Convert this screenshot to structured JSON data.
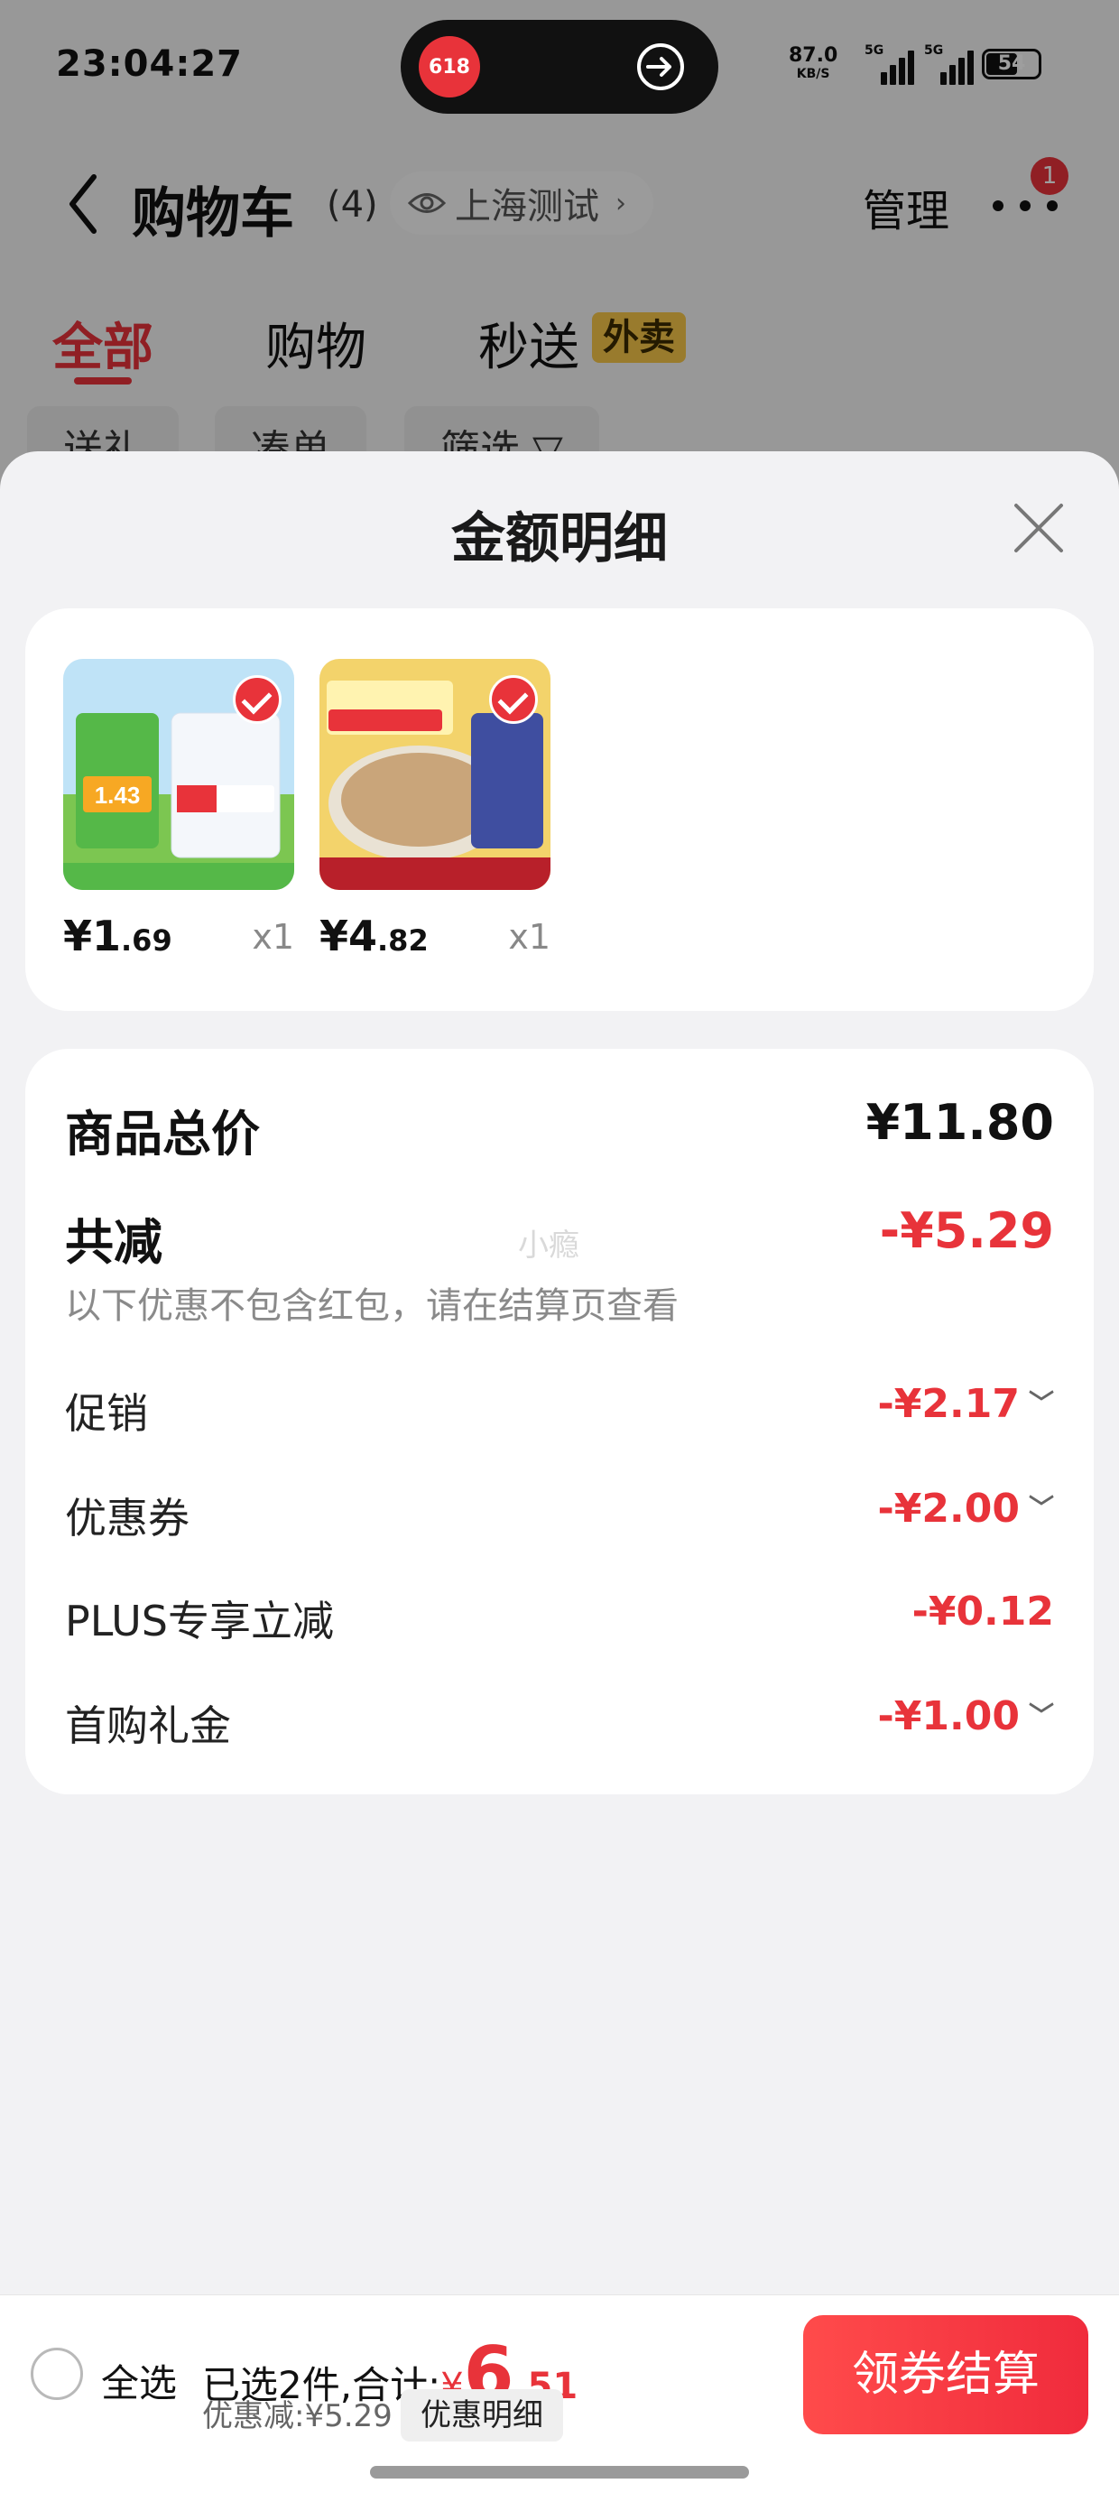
{
  "status_bar": {
    "time": "23:04:27",
    "island_logo": "618",
    "net_speed": "87.0",
    "net_unit": "KB/S",
    "sim1": "5G",
    "sim2": "5G",
    "battery": "54"
  },
  "nav": {
    "title": "购物车",
    "count": "(4)",
    "location": "上海测试",
    "manage": "管理",
    "badge": "1"
  },
  "tabs": [
    {
      "label": "全部",
      "active": true
    },
    {
      "label": "购物",
      "active": false
    },
    {
      "label": "秒送",
      "active": false
    }
  ],
  "tab_tag": "外卖",
  "chips": [
    "送礼",
    "凑单",
    "筛选 ▽"
  ],
  "sheet": {
    "title": "金额明细",
    "products": [
      {
        "price_int": "¥1",
        "price_dec": ".69",
        "qty": "x1",
        "image": "salt-package-image"
      },
      {
        "price_int": "¥4",
        "price_dec": ".82",
        "qty": "x1",
        "image": "oat-rice-package-image"
      }
    ],
    "total_label": "商品总价",
    "total_value": "¥11.80",
    "reduce_label": "共减",
    "reduce_value": "-¥5.29",
    "reduce_note": "以下优惠不包含红包，请在结算页查看",
    "watermark": "小瘾",
    "details": [
      {
        "label": "促销",
        "value": "-¥2.17",
        "expandable": true
      },
      {
        "label": "优惠券",
        "value": "-¥2.00",
        "expandable": true
      },
      {
        "label": "PLUS专享立减",
        "value": "-¥0.12",
        "expandable": false
      },
      {
        "label": "首购礼金",
        "value": "-¥1.00",
        "expandable": true
      }
    ]
  },
  "bottom": {
    "select_all": "全选",
    "summary_prefix": "已选2件,合计:",
    "yen": "¥",
    "amount_int": "6",
    "amount_dec": ".51",
    "discount_text": "优惠减:¥5.29",
    "discount_button": "优惠明细",
    "checkout": "领券结算"
  },
  "colors": {
    "accent": "#e8333a",
    "tag_yellow": "#f7c74a",
    "sheet_bg": "#f2f2f4"
  }
}
